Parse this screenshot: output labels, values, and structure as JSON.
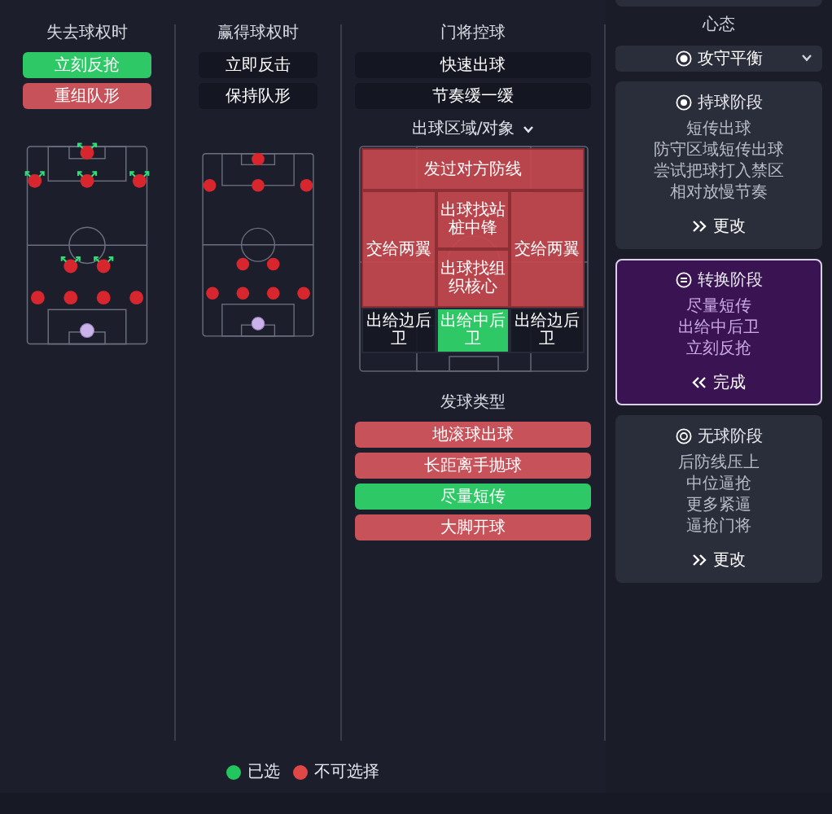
{
  "out_of_possession_transition": {
    "title": "失去球权时",
    "options": [
      {
        "label": "立刻反抢",
        "selected": true,
        "unavailable": false
      },
      {
        "label": "重组队形",
        "selected": false,
        "unavailable": true
      }
    ],
    "formation": [
      {
        "players": [
          {
            "kind": "goalkeeper",
            "pressing": false
          }
        ]
      },
      {
        "players": [
          {
            "kind": "outfield",
            "pressing": false
          },
          {
            "kind": "outfield",
            "pressing": false
          },
          {
            "kind": "outfield",
            "pressing": false
          },
          {
            "kind": "outfield",
            "pressing": false
          }
        ]
      },
      {
        "players": [
          {
            "kind": "outfield",
            "pressing": true
          },
          {
            "kind": "outfield",
            "pressing": true
          }
        ]
      },
      {
        "players": [
          {
            "kind": "outfield",
            "pressing": true
          },
          {
            "kind": "outfield",
            "pressing": true
          },
          {
            "kind": "outfield",
            "pressing": true
          }
        ]
      },
      {
        "players": [
          {
            "kind": "outfield",
            "pressing": true
          }
        ]
      }
    ]
  },
  "in_possession_transition": {
    "title": "赢得球权时",
    "options": [
      {
        "label": "立即反击",
        "selected": false,
        "unavailable": false
      },
      {
        "label": "保持队形",
        "selected": false,
        "unavailable": false
      }
    ],
    "formation": [
      {
        "players": [
          {
            "kind": "goalkeeper",
            "pressing": false
          }
        ]
      },
      {
        "players": [
          {
            "kind": "outfield",
            "pressing": false
          },
          {
            "kind": "outfield",
            "pressing": false
          },
          {
            "kind": "outfield",
            "pressing": false
          },
          {
            "kind": "outfield",
            "pressing": false
          }
        ]
      },
      {
        "players": [
          {
            "kind": "outfield",
            "pressing": false
          },
          {
            "kind": "outfield",
            "pressing": false
          }
        ]
      },
      {
        "players": [
          {
            "kind": "outfield",
            "pressing": false
          },
          {
            "kind": "outfield",
            "pressing": false
          },
          {
            "kind": "outfield",
            "pressing": false
          }
        ]
      },
      {
        "players": [
          {
            "kind": "outfield",
            "pressing": false
          }
        ]
      }
    ]
  },
  "goalkeeper_in_possession": {
    "title": "门将控球",
    "options": [
      {
        "label": "快速出球",
        "selected": false,
        "unavailable": false
      },
      {
        "label": "节奏缓一缓",
        "selected": false,
        "unavailable": false
      }
    ],
    "zone_dropdown": "出球区域/对象",
    "zones": [
      {
        "label": "发过对方防线",
        "selected": false,
        "unavailable": true
      },
      {
        "label": "交给两翼",
        "selected": false,
        "unavailable": true
      },
      {
        "label": "出球找站桩中锋",
        "selected": false,
        "unavailable": true
      },
      {
        "label": "交给两翼",
        "selected": false,
        "unavailable": true
      },
      {
        "label": "出球找组织核心",
        "selected": false,
        "unavailable": true
      },
      {
        "label": "出给边后卫",
        "selected": false,
        "unavailable": false
      },
      {
        "label": "出给中后卫",
        "selected": true,
        "unavailable": false
      },
      {
        "label": "出给边后卫",
        "selected": false,
        "unavailable": false
      }
    ],
    "distribution_title": "发球类型",
    "distribution_types": [
      {
        "label": "地滚球出球",
        "selected": false,
        "unavailable": true
      },
      {
        "label": "长距离手抛球",
        "selected": false,
        "unavailable": true
      },
      {
        "label": "尽量短传",
        "selected": true,
        "unavailable": false
      },
      {
        "label": "大脚开球",
        "selected": false,
        "unavailable": true
      }
    ]
  },
  "legend": [
    {
      "label": "已选",
      "color": "#22c55e"
    },
    {
      "label": "不可选择",
      "color": "#e04848"
    }
  ],
  "mentality": {
    "label": "心态",
    "value": "攻守平衡"
  },
  "phases": [
    {
      "kind": "in_possession",
      "title": "持球阶段",
      "lines": [
        "短传出球",
        "防守区域短传出球",
        "尝试把球打入禁区",
        "相对放慢节奏"
      ],
      "action": "更改",
      "selected": false
    },
    {
      "kind": "transition",
      "title": "转换阶段",
      "lines": [
        "尽量短传",
        "出给中后卫",
        "立刻反抢"
      ],
      "action": "完成",
      "selected": true
    },
    {
      "kind": "out_of_possession",
      "title": "无球阶段",
      "lines": [
        "后防线压上",
        "中位逼抢",
        "更多紧逼",
        "逼抢门将"
      ],
      "action": "更改",
      "selected": false
    }
  ]
}
